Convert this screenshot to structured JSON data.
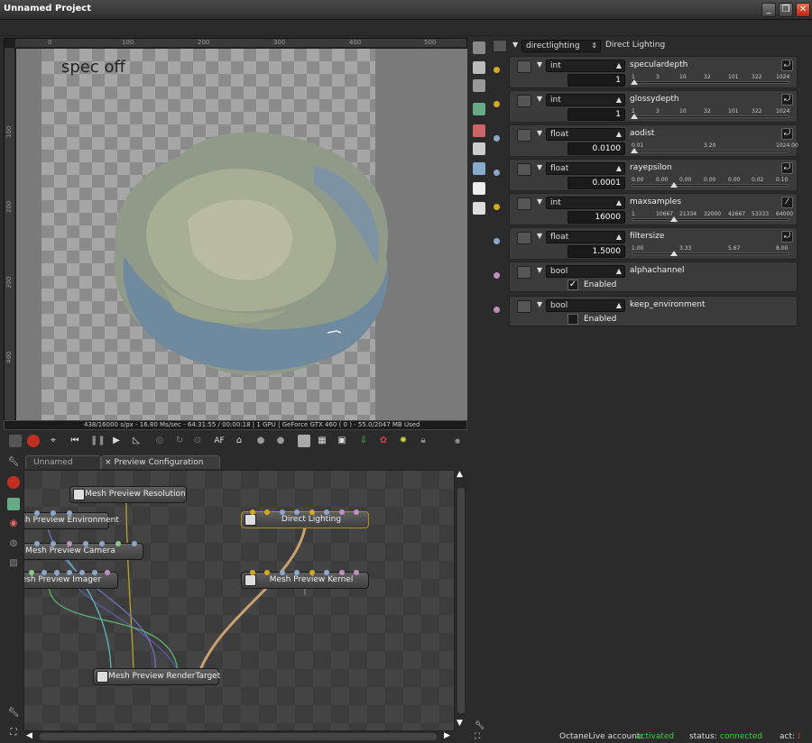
{
  "window": {
    "title": "Unnamed Project",
    "minimize": "_",
    "restore": "❐",
    "close": "✕"
  },
  "viewport": {
    "caption": "spec off",
    "ruler_h": [
      "0",
      "100",
      "200",
      "300",
      "400",
      "500"
    ],
    "ruler_v": [
      "100",
      "200",
      "300",
      "400"
    ],
    "status": "438/16000 s/px - 16.80 Ms/sec - 64:31:55 / 00:00:18 | 1 GPU | GeForce GTX 460 ( 0 ) - 55.0/2047 MB Used"
  },
  "render_toolbar": {
    "af_label": "AF"
  },
  "graph": {
    "tabs": [
      {
        "label": "Unnamed Project",
        "active": false
      },
      {
        "label": "Preview Configuration",
        "active": true,
        "close": "×"
      }
    ],
    "nodes": [
      {
        "label": "Mesh Preview Resolution"
      },
      {
        "label": "Mesh Preview Environment"
      },
      {
        "label": "Mesh Preview Camera"
      },
      {
        "label": "Mesh Preview Imager"
      },
      {
        "label": "Direct Lighting"
      },
      {
        "label": "Mesh Preview Kernel"
      },
      {
        "label": "Mesh Preview RenderTarget"
      }
    ]
  },
  "inspector": {
    "header_type": "directlighting",
    "header_name": "Direct Lighting",
    "rows": [
      {
        "type": "int",
        "name": "speculardepth",
        "value": "1",
        "ticks": [
          "1",
          "3",
          "10",
          "32",
          "101",
          "322",
          "1024"
        ],
        "dot_color": "#d4a820",
        "thumb": 0
      },
      {
        "type": "int",
        "name": "glossydepth",
        "value": "1",
        "ticks": [
          "1",
          "3",
          "10",
          "32",
          "101",
          "322",
          "1024"
        ],
        "dot_color": "#d4a820",
        "thumb": 0
      },
      {
        "type": "float",
        "name": "aodist",
        "value": "0.0100",
        "ticks": [
          "0.01",
          "3.20",
          "1024.00"
        ],
        "dot_color": "#8ea6c8",
        "thumb": 0
      },
      {
        "type": "float",
        "name": "rayepsilon",
        "value": "0.0001",
        "ticks": [
          "0.00",
          "0.00",
          "0.00",
          "0.00",
          "0.00",
          "0.02",
          "0.10"
        ],
        "dot_color": "#8ea6c8",
        "thumb": 0.25
      },
      {
        "type": "int",
        "name": "maxsamples",
        "value": "16000",
        "ticks": [
          "1",
          "10667",
          "21334",
          "32000",
          "42667",
          "53333",
          "64000"
        ],
        "dot_color": "#d4a820",
        "thumb": 0.25
      },
      {
        "type": "float",
        "name": "filtersize",
        "value": "1.5000",
        "ticks": [
          "1.00",
          "3.33",
          "5.67",
          "8.00"
        ],
        "dot_color": "#8ea6c8",
        "thumb": 0.25
      },
      {
        "type": "bool",
        "name": "alphachannel",
        "checked": true,
        "check_label": "Enabled",
        "dot_color": "#c090c0"
      },
      {
        "type": "bool",
        "name": "keep_environment",
        "checked": false,
        "check_label": "Enabled",
        "dot_color": "#c090c0"
      }
    ]
  },
  "footer": {
    "account_label": "OctaneLive account:",
    "account_value": "activated",
    "status_label": "status:",
    "status_value": "connected",
    "act_label": "act:",
    "accent_green": "#40d040"
  }
}
